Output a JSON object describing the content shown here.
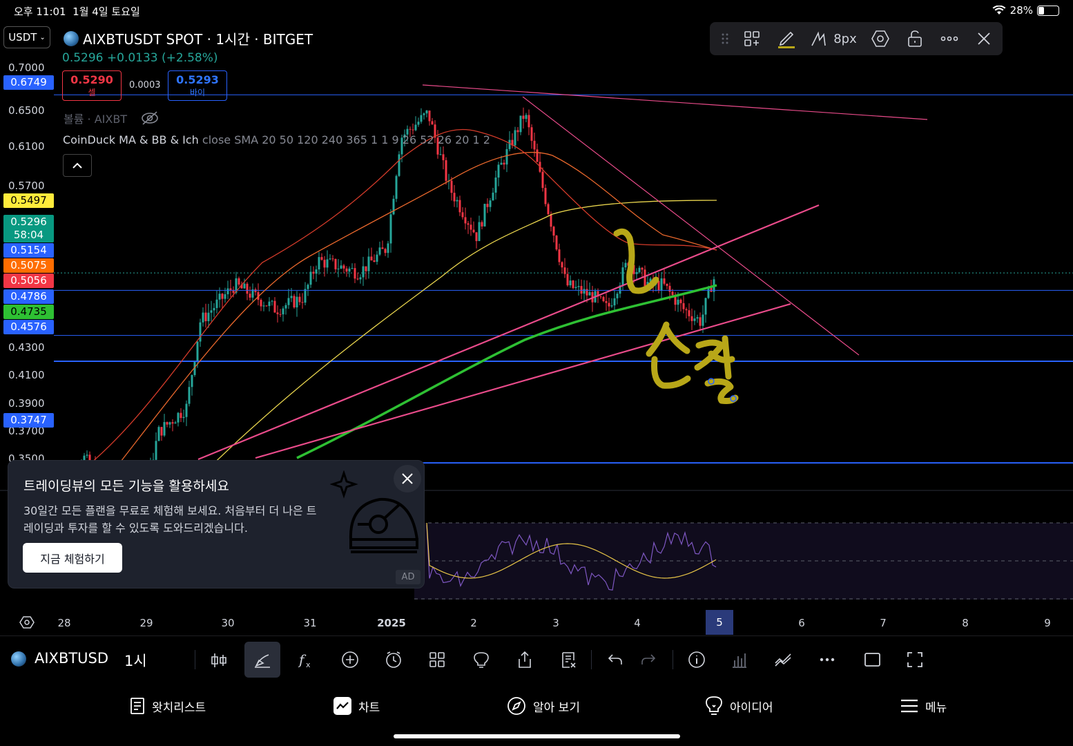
{
  "status_bar": {
    "time": "오후 11:01",
    "date": "1월 4일 토요일",
    "battery": "28%",
    "battery_level": 0.28
  },
  "chart_header": {
    "currency": "USDT",
    "title": "AIXBTUSDT SPOT · 1시간 · BITGET",
    "quote": "0.5296 +0.0133 (+2.58%)",
    "sell_price": "0.5290",
    "sell_label": "셀",
    "spread": "0.0003",
    "buy_price": "0.5293",
    "buy_label": "바이",
    "volume_label": "볼륨 · AIXBT",
    "indicator_name": "CoinDuck MA & BB & Ich",
    "indicator_params": "close SMA 20 50 120 240 365 1 1 9 26 52 26 20 1 2"
  },
  "price_axis": {
    "ticks": [
      "0.7000",
      "0.6500",
      "0.6100",
      "0.5700",
      "0.4300",
      "0.4100",
      "0.3900",
      "0.3700",
      "0.3500"
    ],
    "badges": [
      {
        "value": "0.6749",
        "bg": "#2962ff",
        "fg": "#ffffff"
      },
      {
        "value": "0.5497",
        "bg": "#ffeb3b",
        "fg": "#000000"
      },
      {
        "value": "0.5154",
        "bg": "#2962ff",
        "fg": "#ffffff"
      },
      {
        "value": "0.5075",
        "bg": "#ff6d00",
        "fg": "#ffffff"
      },
      {
        "value": "0.5056",
        "bg": "#f23645",
        "fg": "#ffffff"
      },
      {
        "value": "0.4786",
        "bg": "#2962ff",
        "fg": "#ffffff"
      },
      {
        "value": "0.4735",
        "bg": "#2ec033",
        "fg": "#000000"
      },
      {
        "value": "0.4576",
        "bg": "#2962ff",
        "fg": "#ffffff"
      },
      {
        "value": "0.3747",
        "bg": "#2962ff",
        "fg": "#ffffff"
      }
    ],
    "current": {
      "value": "0.5296",
      "countdown": "58:04",
      "bg": "#089981"
    }
  },
  "drawing_toolbar": {
    "size_label": "8px",
    "icons": [
      "drag-handle-icon",
      "add-to-favorites-icon",
      "pencil-icon",
      "line-width-icon",
      "settings-icon",
      "lock-icon",
      "more-icon",
      "close-icon"
    ]
  },
  "annotation": {
    "handwritten_text": "손절",
    "color": "#b8a718"
  },
  "promo": {
    "title": "트레이딩뷰의 모든 기능을 활용하세요",
    "body": "30일간 모든 플랜을 무료로 체험해 보세요. 처음부터 더 나은 트레이딩과 투자를 할 수 있도록 도와드리겠습니다.",
    "button": "지금 체험하기",
    "ad_label": "AD"
  },
  "time_axis": {
    "labels": [
      "28",
      "29",
      "30",
      "31",
      "2025",
      "2",
      "3",
      "4",
      "5",
      "6",
      "7",
      "8",
      "9"
    ],
    "current": "5"
  },
  "bottom_toolbar": {
    "symbol": "AIXBTUSD",
    "interval": "1시",
    "icons": [
      "candle-type-icon",
      "drawing-tools-icon",
      "indicators-icon",
      "add-icon",
      "alert-icon",
      "layout-icon",
      "ideas-icon",
      "share-icon",
      "trade-list-icon",
      "undo-icon",
      "redo-icon",
      "info-icon",
      "volume-icon",
      "compare-icon",
      "more-icon",
      "rectangle-icon",
      "fullscreen-icon"
    ]
  },
  "tab_bar": {
    "tabs": [
      {
        "label": "왓치리스트",
        "icon": "watchlist-icon"
      },
      {
        "label": "차트",
        "icon": "chart-icon"
      },
      {
        "label": "알아 보기",
        "icon": "explore-icon"
      },
      {
        "label": "아이디어",
        "icon": "ideas-icon"
      },
      {
        "label": "메뉴",
        "icon": "menu-icon"
      }
    ]
  },
  "colors": {
    "up": "#26a69a",
    "down": "#f23645",
    "level_line": "#2962ff",
    "trend_line": "#e94b8a",
    "ma_yellow": "#e8d44d",
    "ma_orange": "#e8672c",
    "ma_red": "#d43b2a",
    "ma_green": "#2ec033"
  }
}
